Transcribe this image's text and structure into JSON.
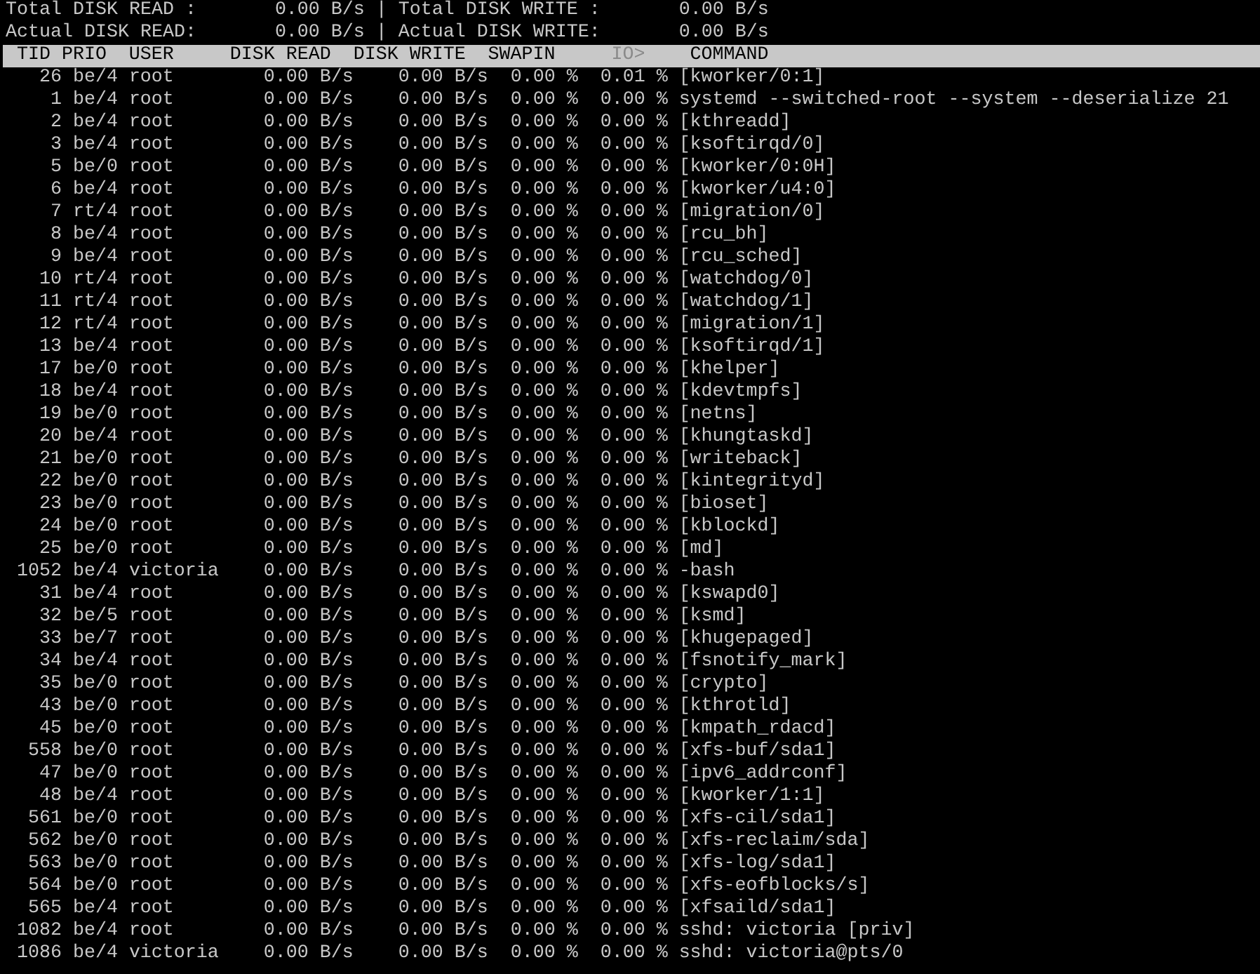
{
  "totals": [
    {
      "label": "Total DISK READ :",
      "value": "0.00 B/s",
      "separator": "|",
      "label2": "Total DISK WRITE :",
      "value2": "0.00 B/s"
    },
    {
      "label": "Actual DISK READ:",
      "value": "0.00 B/s",
      "separator": "|",
      "label2": "Actual DISK WRITE:",
      "value2": "0.00 B/s"
    }
  ],
  "columns": [
    {
      "label": "TID",
      "sorted": false
    },
    {
      "label": "PRIO",
      "sorted": false
    },
    {
      "label": "USER",
      "sorted": false
    },
    {
      "label": "DISK READ",
      "sorted": false
    },
    {
      "label": "DISK WRITE",
      "sorted": false
    },
    {
      "label": "SWAPIN",
      "sorted": false
    },
    {
      "label": "IO>",
      "sorted": true
    },
    {
      "label": "COMMAND",
      "sorted": false
    }
  ],
  "rows": [
    [
      "26",
      "be/4",
      "root",
      "0.00 B/s",
      "0.00 B/s",
      "0.00 %",
      "0.01 %",
      "[kworker/0:1]"
    ],
    [
      "1",
      "be/4",
      "root",
      "0.00 B/s",
      "0.00 B/s",
      "0.00 %",
      "0.00 %",
      "systemd --switched-root --system --deserialize 21"
    ],
    [
      "2",
      "be/4",
      "root",
      "0.00 B/s",
      "0.00 B/s",
      "0.00 %",
      "0.00 %",
      "[kthreadd]"
    ],
    [
      "3",
      "be/4",
      "root",
      "0.00 B/s",
      "0.00 B/s",
      "0.00 %",
      "0.00 %",
      "[ksoftirqd/0]"
    ],
    [
      "5",
      "be/0",
      "root",
      "0.00 B/s",
      "0.00 B/s",
      "0.00 %",
      "0.00 %",
      "[kworker/0:0H]"
    ],
    [
      "6",
      "be/4",
      "root",
      "0.00 B/s",
      "0.00 B/s",
      "0.00 %",
      "0.00 %",
      "[kworker/u4:0]"
    ],
    [
      "7",
      "rt/4",
      "root",
      "0.00 B/s",
      "0.00 B/s",
      "0.00 %",
      "0.00 %",
      "[migration/0]"
    ],
    [
      "8",
      "be/4",
      "root",
      "0.00 B/s",
      "0.00 B/s",
      "0.00 %",
      "0.00 %",
      "[rcu_bh]"
    ],
    [
      "9",
      "be/4",
      "root",
      "0.00 B/s",
      "0.00 B/s",
      "0.00 %",
      "0.00 %",
      "[rcu_sched]"
    ],
    [
      "10",
      "rt/4",
      "root",
      "0.00 B/s",
      "0.00 B/s",
      "0.00 %",
      "0.00 %",
      "[watchdog/0]"
    ],
    [
      "11",
      "rt/4",
      "root",
      "0.00 B/s",
      "0.00 B/s",
      "0.00 %",
      "0.00 %",
      "[watchdog/1]"
    ],
    [
      "12",
      "rt/4",
      "root",
      "0.00 B/s",
      "0.00 B/s",
      "0.00 %",
      "0.00 %",
      "[migration/1]"
    ],
    [
      "13",
      "be/4",
      "root",
      "0.00 B/s",
      "0.00 B/s",
      "0.00 %",
      "0.00 %",
      "[ksoftirqd/1]"
    ],
    [
      "17",
      "be/0",
      "root",
      "0.00 B/s",
      "0.00 B/s",
      "0.00 %",
      "0.00 %",
      "[khelper]"
    ],
    [
      "18",
      "be/4",
      "root",
      "0.00 B/s",
      "0.00 B/s",
      "0.00 %",
      "0.00 %",
      "[kdevtmpfs]"
    ],
    [
      "19",
      "be/0",
      "root",
      "0.00 B/s",
      "0.00 B/s",
      "0.00 %",
      "0.00 %",
      "[netns]"
    ],
    [
      "20",
      "be/4",
      "root",
      "0.00 B/s",
      "0.00 B/s",
      "0.00 %",
      "0.00 %",
      "[khungtaskd]"
    ],
    [
      "21",
      "be/0",
      "root",
      "0.00 B/s",
      "0.00 B/s",
      "0.00 %",
      "0.00 %",
      "[writeback]"
    ],
    [
      "22",
      "be/0",
      "root",
      "0.00 B/s",
      "0.00 B/s",
      "0.00 %",
      "0.00 %",
      "[kintegrityd]"
    ],
    [
      "23",
      "be/0",
      "root",
      "0.00 B/s",
      "0.00 B/s",
      "0.00 %",
      "0.00 %",
      "[bioset]"
    ],
    [
      "24",
      "be/0",
      "root",
      "0.00 B/s",
      "0.00 B/s",
      "0.00 %",
      "0.00 %",
      "[kblockd]"
    ],
    [
      "25",
      "be/0",
      "root",
      "0.00 B/s",
      "0.00 B/s",
      "0.00 %",
      "0.00 %",
      "[md]"
    ],
    [
      "1052",
      "be/4",
      "victoria",
      "0.00 B/s",
      "0.00 B/s",
      "0.00 %",
      "0.00 %",
      "-bash"
    ],
    [
      "31",
      "be/4",
      "root",
      "0.00 B/s",
      "0.00 B/s",
      "0.00 %",
      "0.00 %",
      "[kswapd0]"
    ],
    [
      "32",
      "be/5",
      "root",
      "0.00 B/s",
      "0.00 B/s",
      "0.00 %",
      "0.00 %",
      "[ksmd]"
    ],
    [
      "33",
      "be/7",
      "root",
      "0.00 B/s",
      "0.00 B/s",
      "0.00 %",
      "0.00 %",
      "[khugepaged]"
    ],
    [
      "34",
      "be/4",
      "root",
      "0.00 B/s",
      "0.00 B/s",
      "0.00 %",
      "0.00 %",
      "[fsnotify_mark]"
    ],
    [
      "35",
      "be/0",
      "root",
      "0.00 B/s",
      "0.00 B/s",
      "0.00 %",
      "0.00 %",
      "[crypto]"
    ],
    [
      "43",
      "be/0",
      "root",
      "0.00 B/s",
      "0.00 B/s",
      "0.00 %",
      "0.00 %",
      "[kthrotld]"
    ],
    [
      "45",
      "be/0",
      "root",
      "0.00 B/s",
      "0.00 B/s",
      "0.00 %",
      "0.00 %",
      "[kmpath_rdacd]"
    ],
    [
      "558",
      "be/0",
      "root",
      "0.00 B/s",
      "0.00 B/s",
      "0.00 %",
      "0.00 %",
      "[xfs-buf/sda1]"
    ],
    [
      "47",
      "be/0",
      "root",
      "0.00 B/s",
      "0.00 B/s",
      "0.00 %",
      "0.00 %",
      "[ipv6_addrconf]"
    ],
    [
      "48",
      "be/4",
      "root",
      "0.00 B/s",
      "0.00 B/s",
      "0.00 %",
      "0.00 %",
      "[kworker/1:1]"
    ],
    [
      "561",
      "be/0",
      "root",
      "0.00 B/s",
      "0.00 B/s",
      "0.00 %",
      "0.00 %",
      "[xfs-cil/sda1]"
    ],
    [
      "562",
      "be/0",
      "root",
      "0.00 B/s",
      "0.00 B/s",
      "0.00 %",
      "0.00 %",
      "[xfs-reclaim/sda]"
    ],
    [
      "563",
      "be/0",
      "root",
      "0.00 B/s",
      "0.00 B/s",
      "0.00 %",
      "0.00 %",
      "[xfs-log/sda1]"
    ],
    [
      "564",
      "be/0",
      "root",
      "0.00 B/s",
      "0.00 B/s",
      "0.00 %",
      "0.00 %",
      "[xfs-eofblocks/s]"
    ],
    [
      "565",
      "be/4",
      "root",
      "0.00 B/s",
      "0.00 B/s",
      "0.00 %",
      "0.00 %",
      "[xfsaild/sda1]"
    ],
    [
      "1082",
      "be/4",
      "root",
      "0.00 B/s",
      "0.00 B/s",
      "0.00 %",
      "0.00 %",
      "sshd: victoria [priv]"
    ],
    [
      "1086",
      "be/4",
      "victoria",
      "0.00 B/s",
      "0.00 B/s",
      "0.00 %",
      "0.00 %",
      "sshd: victoria@pts/0"
    ]
  ]
}
